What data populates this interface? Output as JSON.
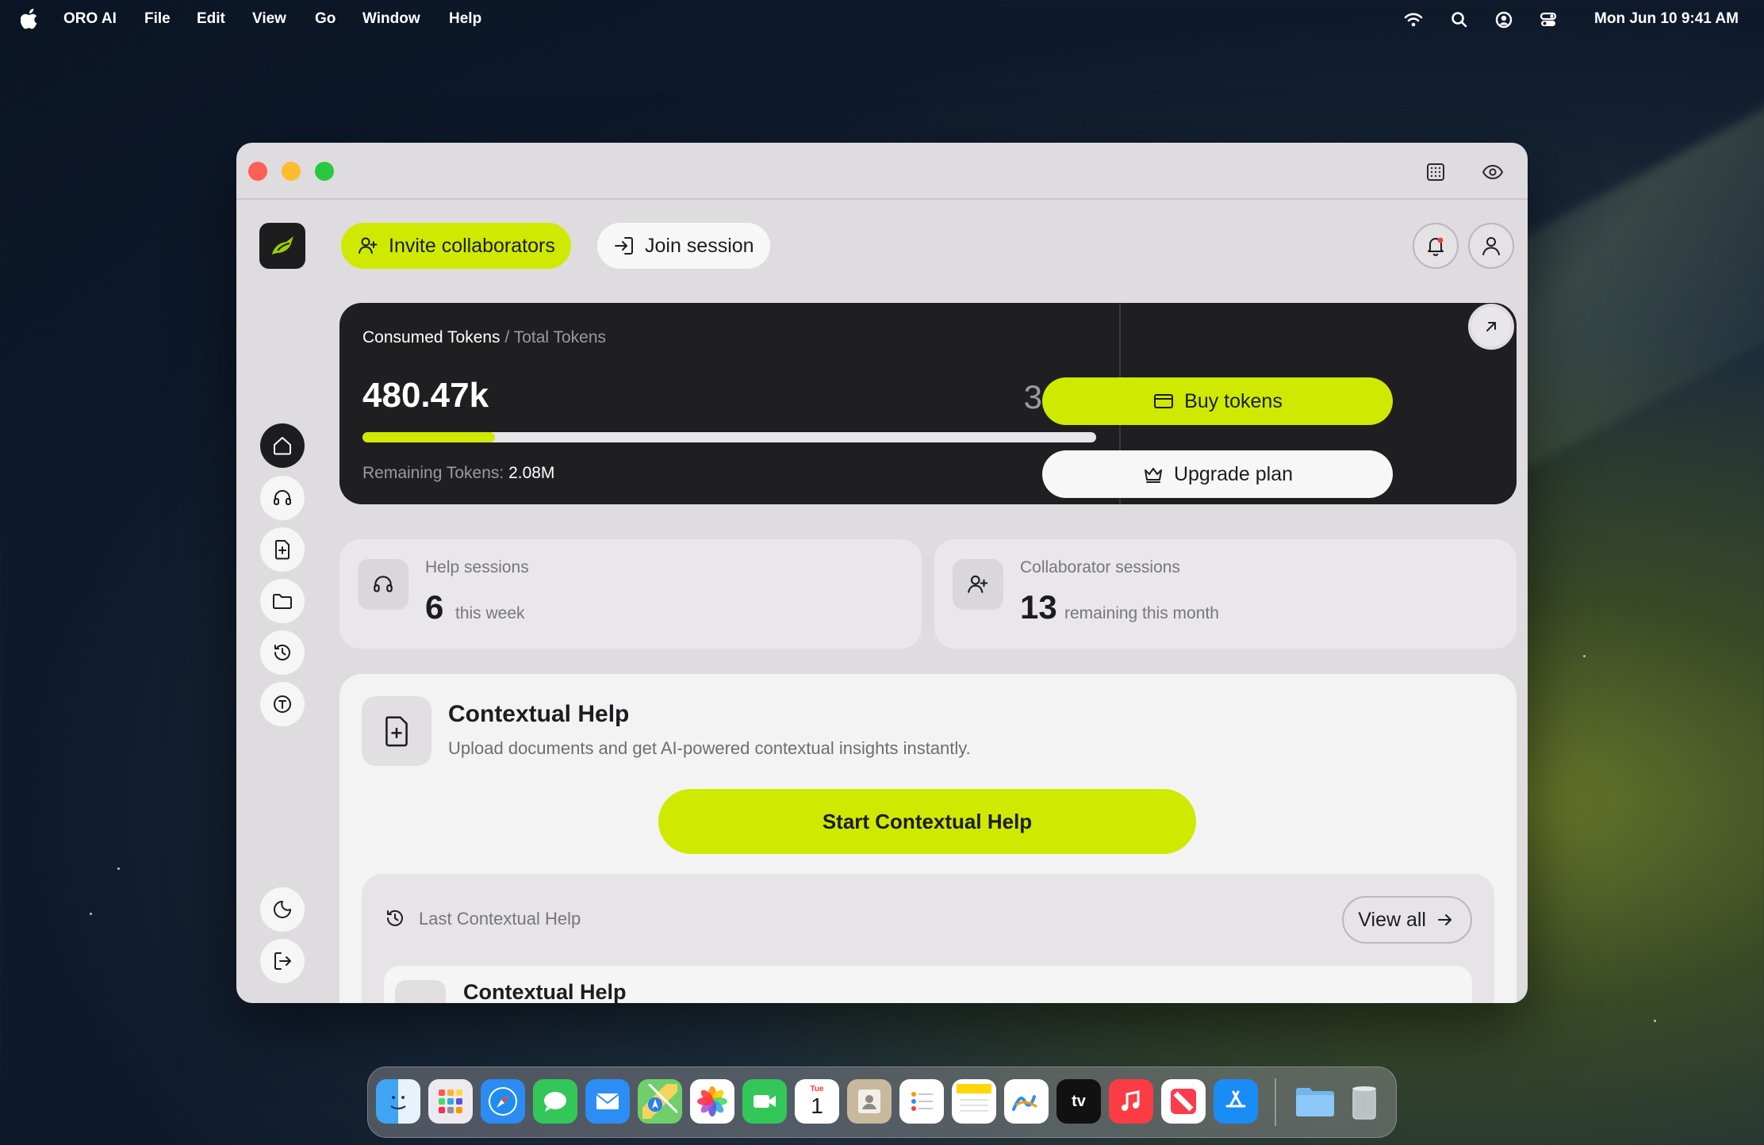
{
  "menubar": {
    "app_name": "ORO AI",
    "menus": [
      "File",
      "Edit",
      "View",
      "Go",
      "Window",
      "Help"
    ],
    "clock": "Mon Jun 10  9:41 AM",
    "status_icons": [
      "wifi-icon",
      "search-icon",
      "user-account-icon",
      "control-center-icon"
    ]
  },
  "window": {
    "traffic_lights": {
      "close": "#fe5f57",
      "minimize": "#febc2e",
      "zoom": "#28c840"
    },
    "title_icons": [
      "layout-grid-icon",
      "eye-icon"
    ]
  },
  "header": {
    "invite_label": "Invite collaborators",
    "join_label": "Join session"
  },
  "sidebar": {
    "items": [
      "home-icon",
      "headset-icon",
      "file-plus-icon",
      "folder-icon",
      "history-icon",
      "token-icon"
    ],
    "bottom": [
      "moon-icon",
      "logout-icon"
    ]
  },
  "tokens": {
    "caption_consumed": "Consumed Tokens",
    "caption_sep": " / ",
    "caption_total": "Total Tokens",
    "consumed": "480.47k",
    "total": "3.5M",
    "progress_fraction": 0.18,
    "remaining_label": "Remaining Tokens: ",
    "remaining_value": "2.08M",
    "buy_label": "Buy tokens",
    "upgrade_label": "Upgrade plan"
  },
  "stats": {
    "help": {
      "label": "Help sessions",
      "value": "6",
      "unit": "this week"
    },
    "collab": {
      "label": "Collaborator sessions",
      "value": "13",
      "unit": "remaining this month"
    }
  },
  "contextual": {
    "title": "Contextual Help",
    "description": "Upload documents and get AI-powered contextual insights instantly.",
    "start_label": "Start Contextual Help",
    "last_title": "Last Contextual Help",
    "view_all_label": "View all",
    "last_item_title": "Contextual Help"
  },
  "dock": {
    "apps": [
      "Finder",
      "Launchpad",
      "Safari",
      "Messages",
      "Mail",
      "Maps",
      "Photos",
      "FaceTime",
      "Calendar",
      "Contacts",
      "Reminders",
      "Notes",
      "Freeform",
      "TV",
      "Music",
      "News",
      "App Store"
    ],
    "calendar_month": "Tue",
    "calendar_day": "1",
    "tv_label": "tv",
    "extras": [
      "Downloads folder",
      "Trash"
    ]
  },
  "colors": {
    "accent": "#cfea00",
    "dark": "#1d1c1f"
  }
}
